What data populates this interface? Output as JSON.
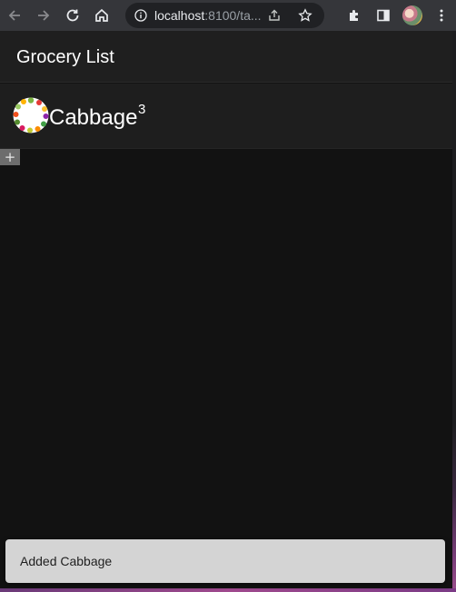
{
  "browser": {
    "url_host": "localhost",
    "url_rest": ":8100/ta..."
  },
  "header": {
    "title": "Grocery List"
  },
  "list": {
    "items": [
      {
        "name": "Cabbage",
        "quantity": "3"
      }
    ],
    "add_label": "+"
  },
  "toast": {
    "message": "Added Cabbage"
  },
  "colors": {
    "chrome": "#35363a",
    "omnibox": "#202124",
    "app_background": "#121212",
    "header_background": "#1f1f1f",
    "toast_background": "#d4d4d4"
  }
}
